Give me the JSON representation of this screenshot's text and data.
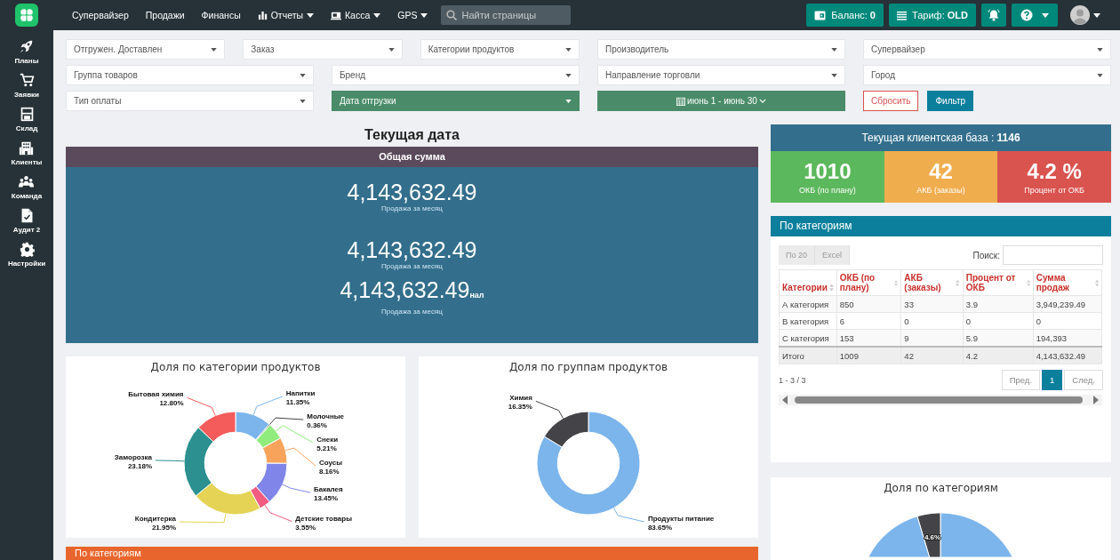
{
  "topbar": {
    "nav": [
      {
        "label": "Супервайзер",
        "kind": "link"
      },
      {
        "label": "Продажи",
        "kind": "link"
      },
      {
        "label": "Финансы",
        "kind": "link"
      },
      {
        "label": "Отчеты",
        "kind": "chart_menu"
      },
      {
        "label": "Касса",
        "kind": "cash_menu"
      },
      {
        "label": "GPS",
        "kind": "menu"
      }
    ],
    "search": {
      "placeholder": "Найти страницы"
    },
    "balance": "Баланс: **0**",
    "tariff": "Тариф: **OLD**"
  },
  "sidebar": {
    "items": [
      {
        "label": "Планы"
      },
      {
        "label": "Заявки"
      },
      {
        "label": "Склад"
      },
      {
        "label": "Клиенты"
      },
      {
        "label": "Команда"
      },
      {
        "label": "Аудит 2"
      },
      {
        "label": "Настройки"
      }
    ]
  },
  "filters": {
    "controls": [
      {
        "label": "Отгружен. Доставлен",
        "kind": "select"
      },
      {
        "label": "Заказ",
        "kind": "select"
      },
      {
        "label": "Категории продуктов",
        "kind": "select"
      },
      {
        "label": "Производитель",
        "kind": "select"
      },
      {
        "label": "Супервайзер",
        "kind": "select"
      },
      {
        "label": "Группа товаров",
        "kind": "select"
      },
      {
        "label": "Бренд",
        "kind": "select"
      },
      {
        "label": "Направление торговли",
        "kind": "select"
      },
      {
        "label": "Город",
        "kind": "select"
      },
      {
        "label": "Тип оплаты",
        "kind": "select"
      },
      {
        "label": "Дата отгрузки",
        "kind": "select_filled"
      },
      {
        "label": "июнь 1 - июнь 30",
        "kind": "date_range"
      }
    ],
    "reset": "Сбросить",
    "apply": "Фильтр"
  },
  "current_date": {
    "title": "Текущая дата",
    "header": "Общая сумма",
    "totals": [
      {
        "value": "4,143,632.49",
        "caption": "Продажа за месяц"
      },
      {
        "value": "4,143,632.49",
        "caption": "Продажа за месяц"
      },
      {
        "value": "4,143,632.49",
        "suffix": "нал",
        "caption": "Продажа за месяц"
      }
    ]
  },
  "product_category_chart": {
    "chart_data": {
      "type": "donut",
      "title": "Доля по категории продуктов",
      "categories": [
        "Напитки",
        "Молочные",
        "Снеки",
        "Соусы",
        "Бакалея",
        "Детские товары",
        "Кондитерка",
        "Заморозка",
        "Бытовая химия"
      ],
      "values": [
        11.35,
        0.36,
        5.21,
        8.16,
        13.45,
        3.55,
        21.95,
        23.18,
        12.8
      ],
      "data_labels": "value_labels",
      "value_labels": [
        "11.35%",
        "0.36%",
        "5.21%",
        "8.16%",
        "13.45%",
        "3.55%",
        "21.95%",
        "23.18%",
        "12.80%"
      ]
    }
  },
  "product_group_chart": {
    "chart_data": {
      "type": "donut",
      "title": "Доля по группам продуктов",
      "categories": [
        "Продукты питание",
        "Химия"
      ],
      "values": [
        83.65,
        16.35
      ],
      "data_labels": "value_labels",
      "value_labels": [
        "83.65%",
        "16.35%"
      ]
    }
  },
  "category_section": {
    "title": "По категориям"
  },
  "client_base": {
    "title": "Текущая клиентская база : **1146**",
    "tiles": [
      {
        "value": "1010",
        "label": "ОКБ (по плану)",
        "color": "#5cb85c"
      },
      {
        "value": "42",
        "label": "АКБ (заказы)",
        "color": "#f0ad4e"
      },
      {
        "value": "4.2 %",
        "label": "Процент от ОКБ",
        "color": "#d9534f"
      }
    ]
  },
  "category_table": {
    "title": "По категориям",
    "buttons": [
      "По 20",
      "Excel"
    ],
    "search_label": "Поиск:",
    "columns": [
      "Категории",
      "ОКБ (по плану)",
      "АКБ (заказы)",
      "Процент от ОКБ",
      "Сумма продаж"
    ],
    "rows": [
      [
        "А категория",
        "850",
        "33",
        "3.9",
        "3,949,239.49"
      ],
      [
        "В категория",
        "6",
        "0",
        "0",
        "0"
      ],
      [
        "С категория",
        "153",
        "9",
        "5.9",
        "194,393"
      ]
    ],
    "footer": [
      "Итого",
      "1009",
      "42",
      "4.2",
      "4,143,632.49"
    ],
    "info": "1 - 3 / 3",
    "pages": [
      {
        "label": "Пред.",
        "selected": false
      },
      {
        "label": "1",
        "selected": true
      },
      {
        "label": "След.",
        "selected": false
      }
    ]
  },
  "category_share_chart": {
    "title": "Доля по категориям",
    "slice_label": "4.6%"
  }
}
